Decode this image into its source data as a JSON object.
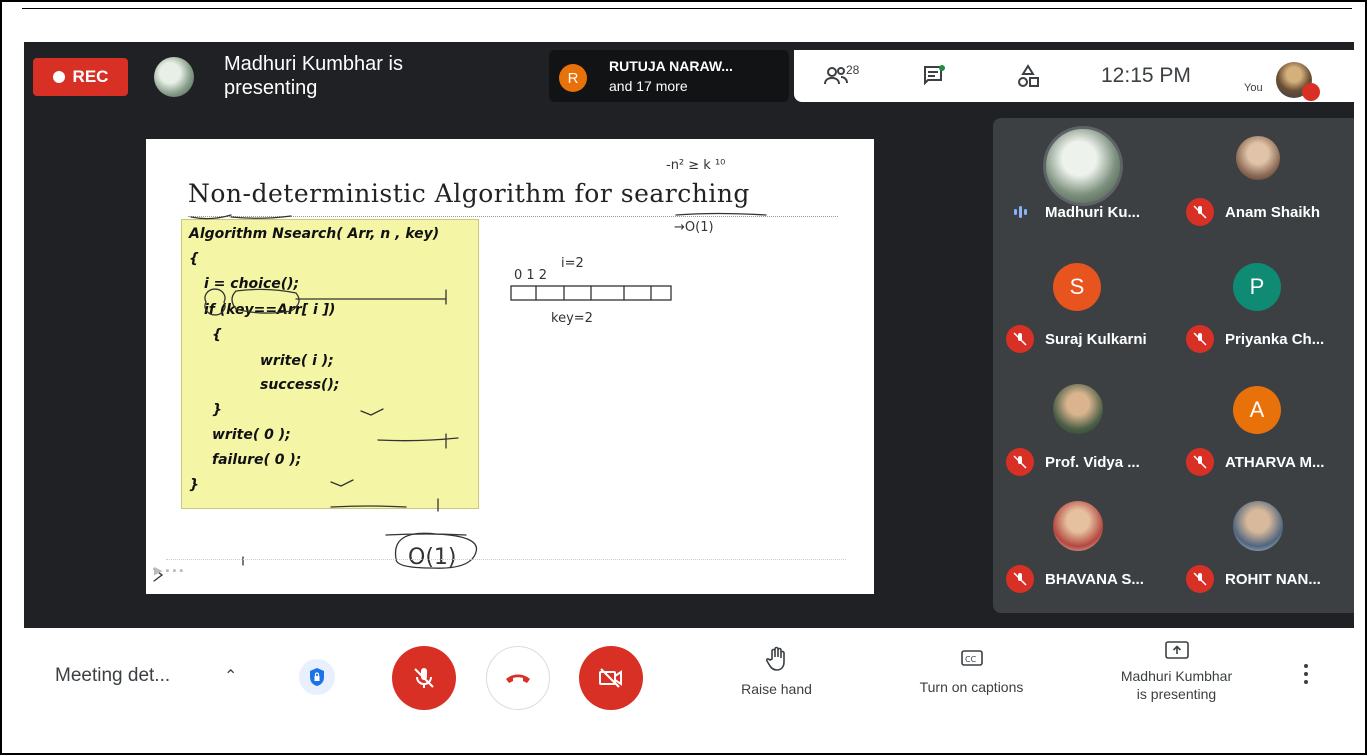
{
  "recording": {
    "label": "REC"
  },
  "presenter": {
    "text_line1": "Madhuri Kumbhar is",
    "text_line2": "presenting"
  },
  "participant_chip": {
    "initial": "R",
    "name": "RUTUJA NARAW...",
    "more": "and 17 more"
  },
  "toolbar": {
    "people_count": "28",
    "clock": "12:15 PM",
    "you_label": "You"
  },
  "slide": {
    "title": "Non-deterministic Algorithm for searching",
    "code_lines": [
      "Algorithm Nsearch( Arr, n , key)",
      "{",
      "i = choice();",
      "if (key==Arr[ i ])",
      "{",
      "write( i );",
      "success();",
      "}",
      "write( 0 );",
      "failure( 0 );",
      "}"
    ],
    "handwriting": {
      "top_right": "-n² ≥ k ¹⁰",
      "under_title": "→O(1)",
      "array_index": "0 1 2",
      "i_eq": "i=2",
      "key": "key=2",
      "big_o": "O(1)"
    }
  },
  "participants": [
    {
      "name": "Madhuri Ku...",
      "initial": "",
      "color": "#6b7a6d",
      "status": "speaking"
    },
    {
      "name": "Anam Shaikh",
      "initial": "",
      "color": "#8b6a55",
      "status": "muted"
    },
    {
      "name": "Suraj Kulkarni",
      "initial": "S",
      "color": "#e8541e",
      "status": "muted"
    },
    {
      "name": "Priyanka Ch...",
      "initial": "P",
      "color": "#0f8a73",
      "status": "muted"
    },
    {
      "name": "Prof. Vidya ...",
      "initial": "",
      "color": "#4a5e45",
      "status": "muted"
    },
    {
      "name": "ATHARVA M...",
      "initial": "A",
      "color": "#e8710a",
      "status": "muted"
    },
    {
      "name": "BHAVANA S...",
      "initial": "",
      "color": "#b4473f",
      "status": "muted"
    },
    {
      "name": "ROHIT NAN...",
      "initial": "",
      "color": "#50657e",
      "status": "muted"
    }
  ],
  "bottom_bar": {
    "meeting_details": "Meeting det...",
    "raise_hand": "Raise hand",
    "captions": "Turn on captions",
    "presenting_line1": "Madhuri Kumbhar",
    "presenting_line2": "is presenting"
  }
}
